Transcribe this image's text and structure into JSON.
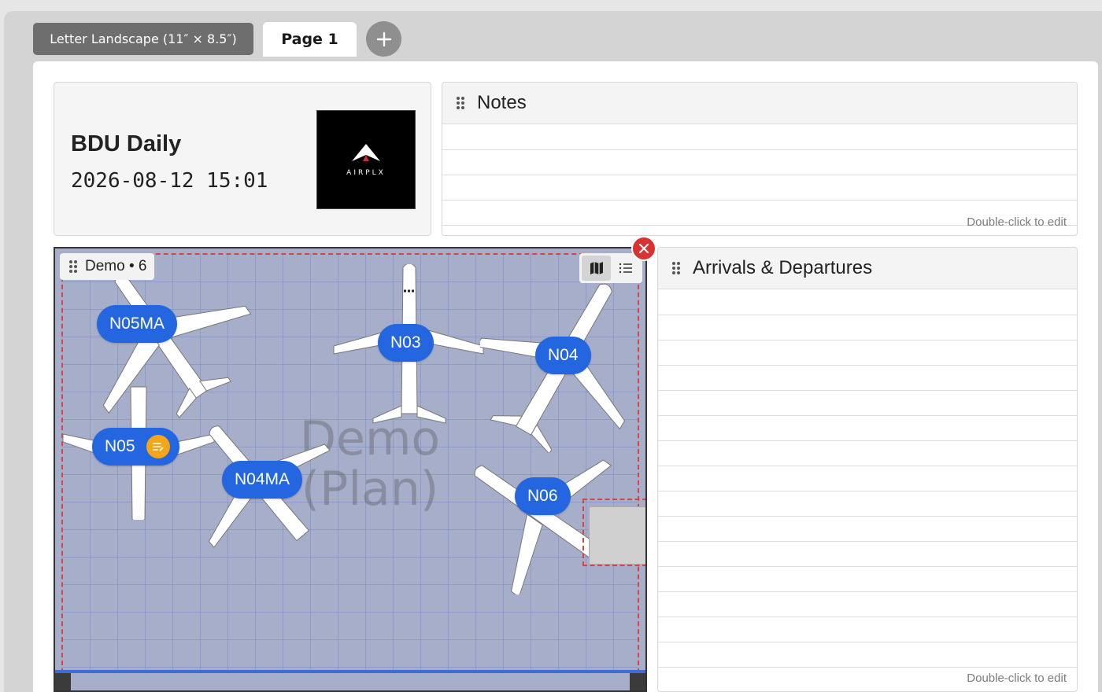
{
  "page_setup": {
    "size_label": "Letter Landscape (11″ × 8.5″)"
  },
  "tabs": [
    {
      "label": "Page 1",
      "active": true
    }
  ],
  "add_page_icon": "plus-icon",
  "title_card": {
    "title": "BDU Daily",
    "datetime": "2026-08-12  15:01",
    "logo_text": "AIRPLX"
  },
  "notes": {
    "title": "Notes",
    "hint": "Double-click to edit"
  },
  "arrivals": {
    "title": "Arrivals & Departures",
    "hint": "Double-click to edit"
  },
  "demo_plan": {
    "label": "Demo • 6",
    "watermark_line1": "Demo",
    "watermark_line2": "(Plan)",
    "view_icons": [
      "map-icon",
      "list-icon"
    ],
    "aircraft": [
      {
        "tail": "N05MA"
      },
      {
        "tail": "N03"
      },
      {
        "tail": "N04"
      },
      {
        "tail": "N05",
        "has_note": true
      },
      {
        "tail": "N04MA"
      },
      {
        "tail": "N06"
      }
    ]
  },
  "colors": {
    "tag_blue": "#2366e0",
    "close_red": "#d83232",
    "note_orange": "#f4a51a",
    "plan_bg": "#a6aec9"
  }
}
